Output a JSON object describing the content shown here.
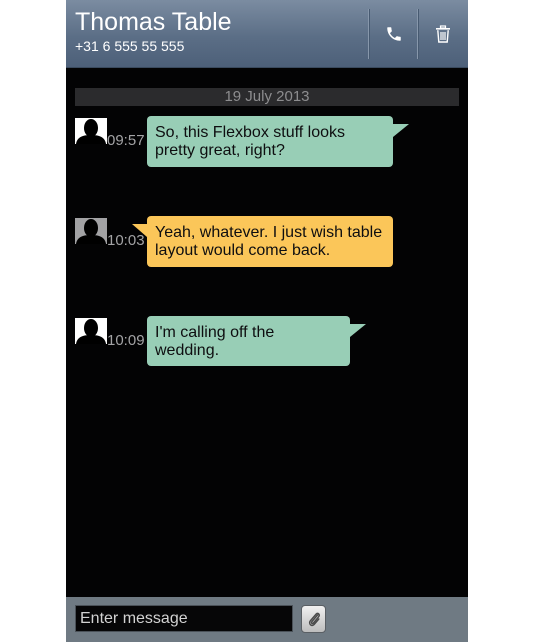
{
  "header": {
    "contact_name": "Thomas Table",
    "contact_number": "+31 6 555 55 555",
    "call_icon": "phone-icon",
    "delete_icon": "trash-icon"
  },
  "conversation": {
    "date": "19 July 2013",
    "messages": [
      {
        "time": "09:57",
        "text": "So, this Flexbox stuff looks pretty great, right?",
        "color": "#98ceb6",
        "avatar": "person-silhouette-icon"
      },
      {
        "time": "10:03",
        "text": "Yeah, whatever. I just wish table layout would come back.",
        "color": "#fbc659",
        "avatar": "person-silhouette-icon"
      },
      {
        "time": "10:09",
        "text": "I'm calling off the wedding.",
        "color": "#98ceb6",
        "avatar": "person-silhouette-icon"
      }
    ]
  },
  "composer": {
    "placeholder": "Enter message",
    "value": "",
    "attach_icon": "paperclip-icon"
  }
}
